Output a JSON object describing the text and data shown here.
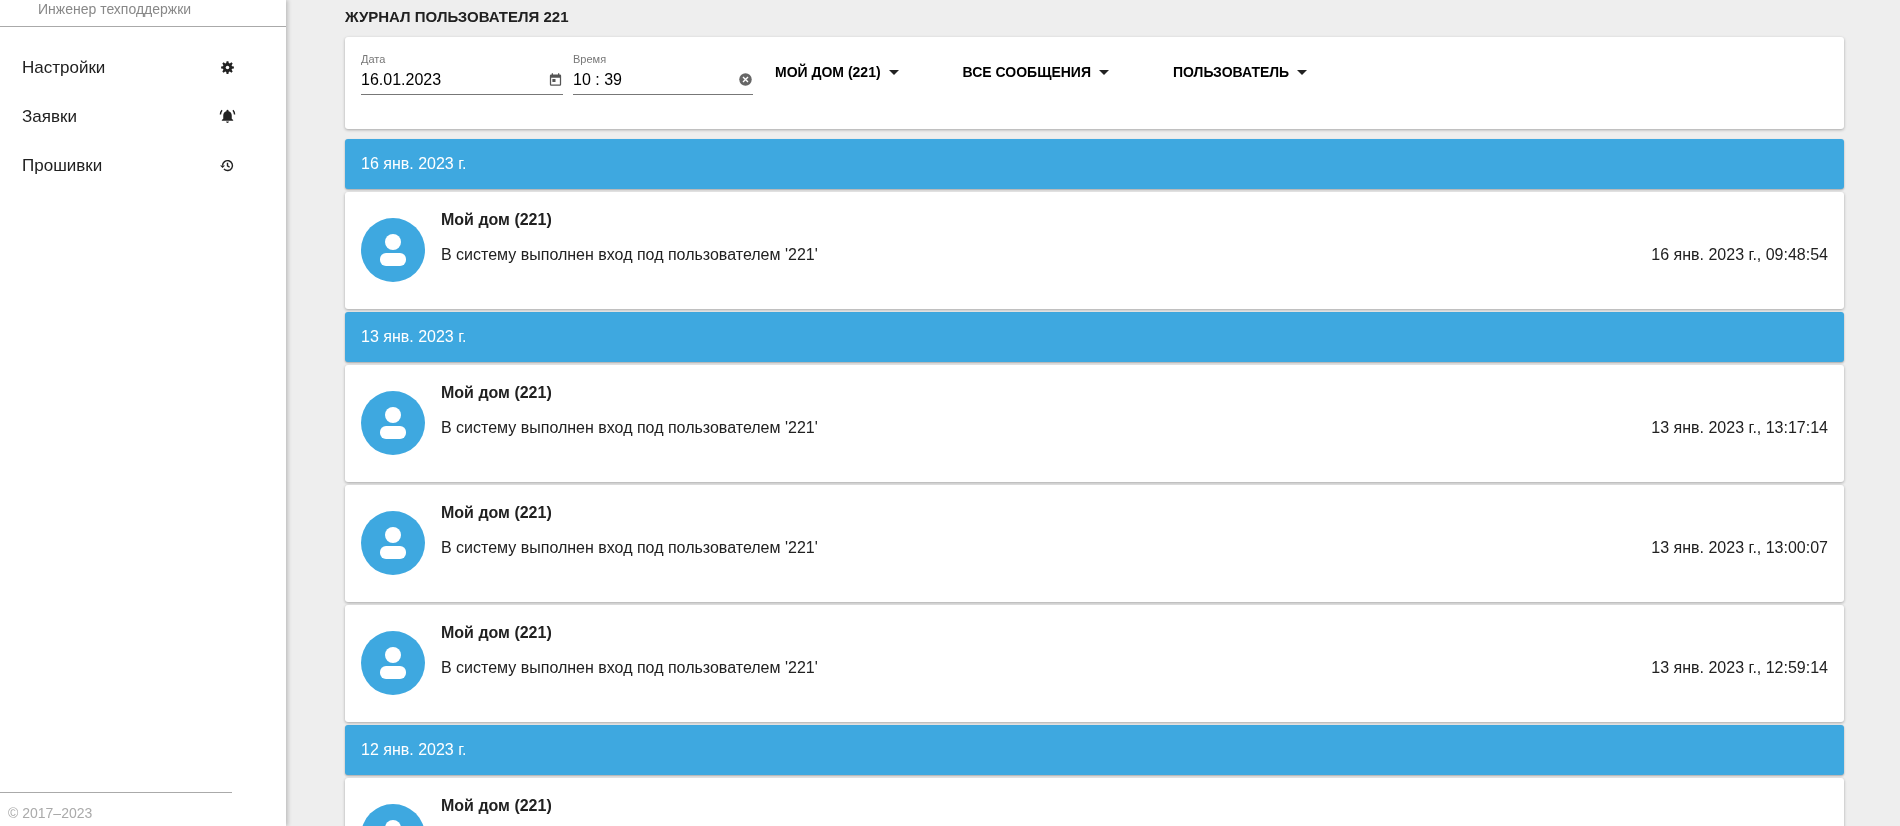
{
  "sidebar": {
    "role": "Инженер техподдержки",
    "items": [
      {
        "label": "Настройки"
      },
      {
        "label": "Заявки"
      },
      {
        "label": "Прошивки"
      }
    ],
    "copyright": "© 2017–2023"
  },
  "title": "ЖУРНАЛ ПОЛЬЗОВАТЕЛЯ 221",
  "filters": {
    "date": {
      "label": "Дата",
      "value": "16.01.2023"
    },
    "time": {
      "label": "Время",
      "value": "10 : 39"
    },
    "dropdowns": [
      "МОЙ ДОМ (221)",
      "ВСЕ СООБЩЕНИЯ",
      "ПОЛЬЗОВАТЕЛЬ"
    ]
  },
  "groups": [
    {
      "date": "16 янв. 2023 г.",
      "entries": [
        {
          "name": "Мой дом (221)",
          "message": "В систему выполнен вход под пользователем '221'",
          "time": "16 янв. 2023 г., 09:48:54"
        }
      ]
    },
    {
      "date": "13 янв. 2023 г.",
      "entries": [
        {
          "name": "Мой дом (221)",
          "message": "В систему выполнен вход под пользователем '221'",
          "time": "13 янв. 2023 г., 13:17:14"
        },
        {
          "name": "Мой дом (221)",
          "message": "В систему выполнен вход под пользователем '221'",
          "time": "13 янв. 2023 г., 13:00:07"
        },
        {
          "name": "Мой дом (221)",
          "message": "В систему выполнен вход под пользователем '221'",
          "time": "13 янв. 2023 г., 12:59:14"
        }
      ]
    },
    {
      "date": "12 янв. 2023 г.",
      "entries": [
        {
          "name": "Мой дом (221)"
        }
      ]
    }
  ]
}
